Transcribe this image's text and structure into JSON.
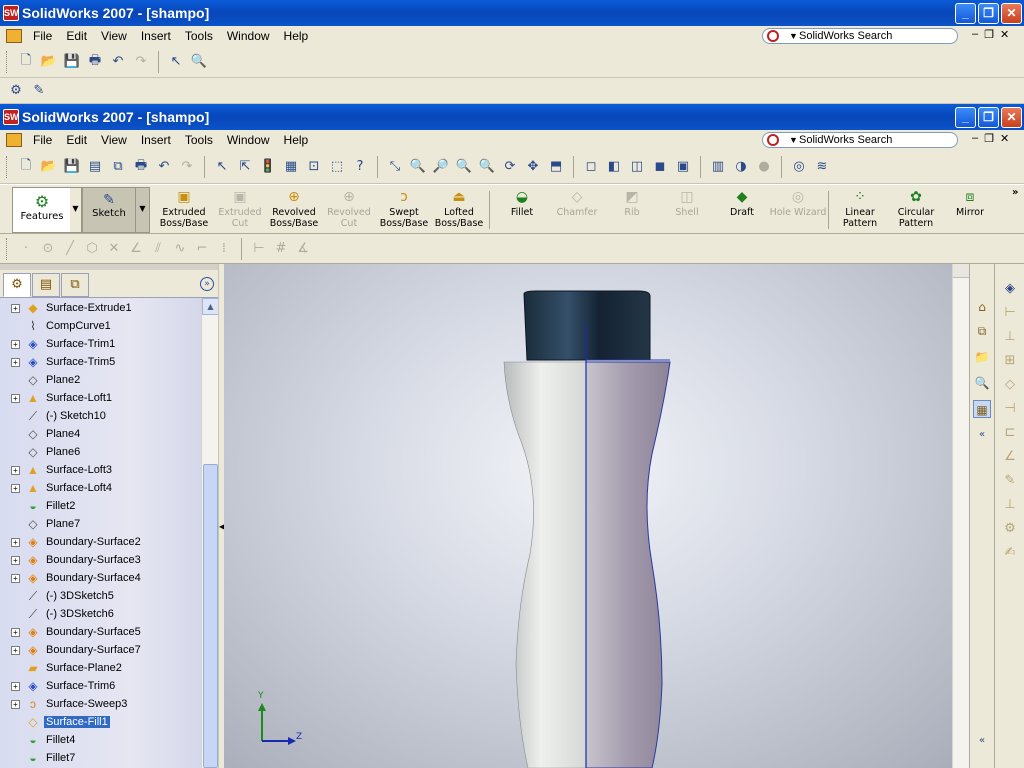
{
  "window": {
    "title": "SolidWorks 2007 - [shampo]",
    "controls": {
      "minimize": "_",
      "restore": "❐",
      "close": "✕"
    }
  },
  "menu": {
    "items": [
      "File",
      "Edit",
      "View",
      "Insert",
      "Tools",
      "Window",
      "Help"
    ],
    "search_placeholder": "SolidWorks Search"
  },
  "command_manager": {
    "features_label": "Features",
    "sketch_label": "Sketch",
    "commands": [
      {
        "label": "Extruded Boss/Base",
        "enabled": true
      },
      {
        "label": "Extruded Cut",
        "enabled": false
      },
      {
        "label": "Revolved Boss/Base",
        "enabled": true
      },
      {
        "label": "Revolved Cut",
        "enabled": false
      },
      {
        "label": "Swept Boss/Base",
        "enabled": true
      },
      {
        "label": "Lofted Boss/Base",
        "enabled": true
      },
      {
        "label": "Fillet",
        "enabled": true
      },
      {
        "label": "Chamfer",
        "enabled": false
      },
      {
        "label": "Rib",
        "enabled": false
      },
      {
        "label": "Shell",
        "enabled": false
      },
      {
        "label": "Draft",
        "enabled": true
      },
      {
        "label": "Hole Wizard",
        "enabled": false
      },
      {
        "label": "Linear Pattern",
        "enabled": true
      },
      {
        "label": "Circular Pattern",
        "enabled": true
      },
      {
        "label": "Mirror",
        "enabled": true
      }
    ]
  },
  "feature_tree": {
    "items": [
      {
        "label": "Surface-Extrude1",
        "expandable": true,
        "icon": "surface-extrude-icon",
        "selected": false
      },
      {
        "label": "CompCurve1",
        "expandable": false,
        "icon": "curve-icon",
        "selected": false
      },
      {
        "label": "Surface-Trim1",
        "expandable": true,
        "icon": "surface-trim-icon",
        "selected": false
      },
      {
        "label": "Surface-Trim5",
        "expandable": true,
        "icon": "surface-trim-icon",
        "selected": false
      },
      {
        "label": "Plane2",
        "expandable": false,
        "icon": "plane-icon",
        "selected": false
      },
      {
        "label": "Surface-Loft1",
        "expandable": true,
        "icon": "surface-loft-icon",
        "selected": false
      },
      {
        "label": "(-) Sketch10",
        "expandable": false,
        "icon": "sketch-icon",
        "selected": false
      },
      {
        "label": "Plane4",
        "expandable": false,
        "icon": "plane-icon",
        "selected": false
      },
      {
        "label": "Plane6",
        "expandable": false,
        "icon": "plane-icon",
        "selected": false
      },
      {
        "label": "Surface-Loft3",
        "expandable": true,
        "icon": "surface-loft-icon",
        "selected": false
      },
      {
        "label": "Surface-Loft4",
        "expandable": true,
        "icon": "surface-loft-icon",
        "selected": false
      },
      {
        "label": "Fillet2",
        "expandable": false,
        "icon": "fillet-icon",
        "selected": false
      },
      {
        "label": "Plane7",
        "expandable": false,
        "icon": "plane-icon",
        "selected": false
      },
      {
        "label": "Boundary-Surface2",
        "expandable": true,
        "icon": "boundary-surface-icon",
        "selected": false
      },
      {
        "label": "Boundary-Surface3",
        "expandable": true,
        "icon": "boundary-surface-icon",
        "selected": false
      },
      {
        "label": "Boundary-Surface4",
        "expandable": true,
        "icon": "boundary-surface-icon",
        "selected": false
      },
      {
        "label": "(-) 3DSketch5",
        "expandable": false,
        "icon": "3dsketch-icon",
        "selected": false
      },
      {
        "label": "(-) 3DSketch6",
        "expandable": false,
        "icon": "3dsketch-icon",
        "selected": false
      },
      {
        "label": "Boundary-Surface5",
        "expandable": true,
        "icon": "boundary-surface-icon",
        "selected": false
      },
      {
        "label": "Boundary-Surface7",
        "expandable": true,
        "icon": "boundary-surface-icon",
        "selected": false
      },
      {
        "label": "Surface-Plane2",
        "expandable": false,
        "icon": "surface-plane-icon",
        "selected": false
      },
      {
        "label": "Surface-Trim6",
        "expandable": true,
        "icon": "surface-trim-icon",
        "selected": false
      },
      {
        "label": "Surface-Sweep3",
        "expandable": true,
        "icon": "surface-sweep-icon",
        "selected": false
      },
      {
        "label": "Surface-Fill1",
        "expandable": false,
        "icon": "surface-fill-icon",
        "selected": true
      },
      {
        "label": "Fillet4",
        "expandable": false,
        "icon": "fillet-icon",
        "selected": false
      },
      {
        "label": "Fillet7",
        "expandable": false,
        "icon": "fillet-icon",
        "selected": false
      }
    ]
  },
  "triad": {
    "y_label": "Y",
    "z_label": "Z"
  },
  "colors": {
    "titlebar": "#0a54c8",
    "selection": "#316ac5",
    "cap": "#1c3346",
    "body": "#d8d8d8"
  }
}
